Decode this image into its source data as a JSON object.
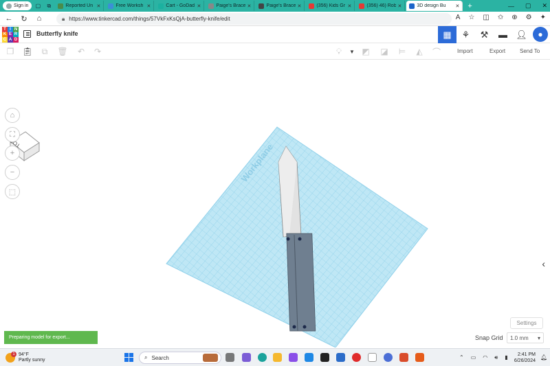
{
  "browser": {
    "signin_label": "Sign in",
    "tabs": [
      {
        "title": "Reported Un",
        "color": "#4a8c4a"
      },
      {
        "title": "Free Worksh",
        "color": "#3c8fd6"
      },
      {
        "title": "Cart - GoDad",
        "color": "#1bb1a0"
      },
      {
        "title": "Paige's Brace",
        "color": "#888888"
      },
      {
        "title": "Paige's Brace",
        "color": "#444444"
      },
      {
        "title": "(356) Kids Gr",
        "color": "#e53935"
      },
      {
        "title": "(356) 46) Rob",
        "color": "#e53935"
      },
      {
        "title": "3D design Bu",
        "color": "#1c64c9",
        "active": true
      }
    ],
    "url": "https://www.tinkercad.com/things/57VkFxKsQjA-butterfly-knife/edit"
  },
  "app": {
    "logo_letters": [
      "TIN",
      "KER",
      "CAD"
    ],
    "logo_colors": [
      "#e53935",
      "#1e88e5",
      "#43a047",
      "#fb8c00",
      "#8e24aa",
      "#00acc1",
      "#fdd835",
      "#5e35b1",
      "#d81b60"
    ],
    "design_title": "Butterfly knife",
    "toolbar": {
      "import_label": "Import",
      "export_label": "Export",
      "sendto_label": "Send To"
    },
    "viewport": {
      "viewcube_label": "TOP",
      "workplane_label": "Workplane",
      "settings_label": "Settings",
      "snap_grid_label": "Snap Grid",
      "snap_grid_value": "1.0 mm",
      "toast_text": "Preparing model for export..."
    }
  },
  "taskbar": {
    "weather_temp": "94°F",
    "weather_desc": "Partly sunny",
    "weather_badge": "1",
    "search_placeholder": "Search",
    "time": "2:41 PM",
    "date": "6/26/2024"
  }
}
